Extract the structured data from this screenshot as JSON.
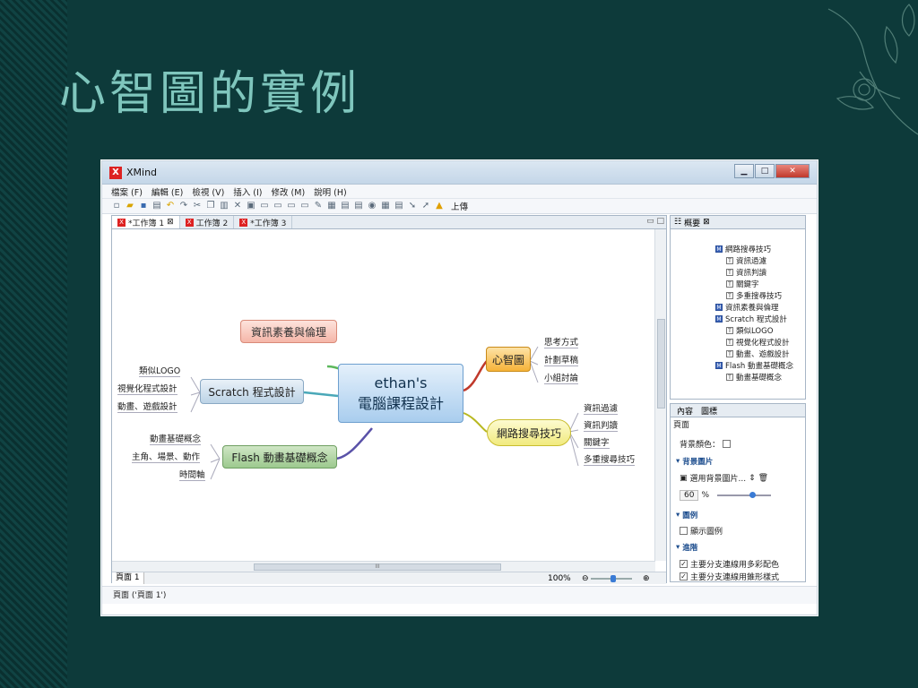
{
  "slide": {
    "title": "心智圖的實例"
  },
  "window": {
    "title": "XMind",
    "logo": "X",
    "controls": {
      "minimize": "▁",
      "maximize": "□",
      "close": "✕"
    },
    "menu": [
      "檔案 (F)",
      "編輯 (E)",
      "檢視 (V)",
      "插入 (I)",
      "修改 (M)",
      "說明 (H)"
    ],
    "toolbar_icons": [
      "new-icon",
      "open-icon",
      "save-icon",
      "print-icon",
      "undo-icon",
      "redo-icon",
      "cut-icon",
      "copy-icon",
      "paste-icon",
      "delete-icon",
      "topic-icon",
      "subtopic-icon",
      "floating-icon",
      "callout-icon",
      "relationship-icon",
      "boundary-icon",
      "summary-icon",
      "marker-icon",
      "image-icon",
      "note-icon",
      "hyperlink-icon",
      "drill-down-icon",
      "drill-up-icon"
    ],
    "upload_label": "上傳",
    "tabs": [
      {
        "label": "*工作簿 1",
        "close": "⊠"
      },
      {
        "label": "工作簿 2"
      },
      {
        "label": "*工作簿 3"
      }
    ]
  },
  "mindmap": {
    "central": {
      "line1": "ethan's",
      "line2": "電腦課程設計"
    },
    "branches": {
      "literacy": {
        "label": "資訊素養與倫理"
      },
      "scratch": {
        "label": "Scratch 程式設計",
        "children": [
          "類似LOGO",
          "視覺化程式設計",
          "動畫、遊戲設計"
        ]
      },
      "flash": {
        "label": "Flash 動畫基礎概念",
        "children": [
          "動畫基礎概念",
          "主角、場景、動作",
          "時間軸"
        ]
      },
      "mindmap": {
        "label": "心智圖",
        "children": [
          "思考方式",
          "計劃草稿",
          "小組討論"
        ]
      },
      "search": {
        "label": "網路搜尋技巧",
        "children": [
          "資訊過濾",
          "資訊判讀",
          "關鍵字",
          "多重搜尋技巧"
        ]
      }
    }
  },
  "editor": {
    "page_tab": "頁面 1",
    "zoom": "100%",
    "zoom_minus": "⊖",
    "zoom_plus": "⊕",
    "scroll_grip": "III"
  },
  "status": {
    "text": "頁面 ('頁面 1')"
  },
  "outline_panel": {
    "title": "概要",
    "items": [
      {
        "icon": "M",
        "label": "網路搜尋技巧",
        "level": 1
      },
      {
        "icon": "T",
        "label": "資訊過濾",
        "level": 2
      },
      {
        "icon": "T",
        "label": "資訊判讀",
        "level": 2
      },
      {
        "icon": "T",
        "label": "關鍵字",
        "level": 2
      },
      {
        "icon": "T",
        "label": "多重搜尋技巧",
        "level": 2
      },
      {
        "icon": "M",
        "label": "資訊素養與倫理",
        "level": 1
      },
      {
        "icon": "M",
        "label": "Scratch 程式設計",
        "level": 1
      },
      {
        "icon": "T",
        "label": "類似LOGO",
        "level": 2
      },
      {
        "icon": "T",
        "label": "視覺化程式設計",
        "level": 2
      },
      {
        "icon": "T",
        "label": "動畫、遊戲設計",
        "level": 2
      },
      {
        "icon": "M",
        "label": "Flash 動畫基礎概念",
        "level": 1
      },
      {
        "icon": "T",
        "label": "動畫基礎概念",
        "level": 2
      }
    ]
  },
  "props_panel": {
    "tab_content": "內容",
    "tab_icon": "圖標",
    "section_page": "頁面",
    "bg_color_label": "背景顏色：",
    "bg_image_section": "背景圖片",
    "choose_bg_image": "選用背景圖片...",
    "opacity_value": "60",
    "opacity_unit": "%",
    "legend_section": "圖例",
    "show_legend": "顯示圖例",
    "advanced_section": "進階",
    "opt1": "主要分支連線用多彩配色",
    "opt2": "主要分支連線用錐形樣式"
  }
}
